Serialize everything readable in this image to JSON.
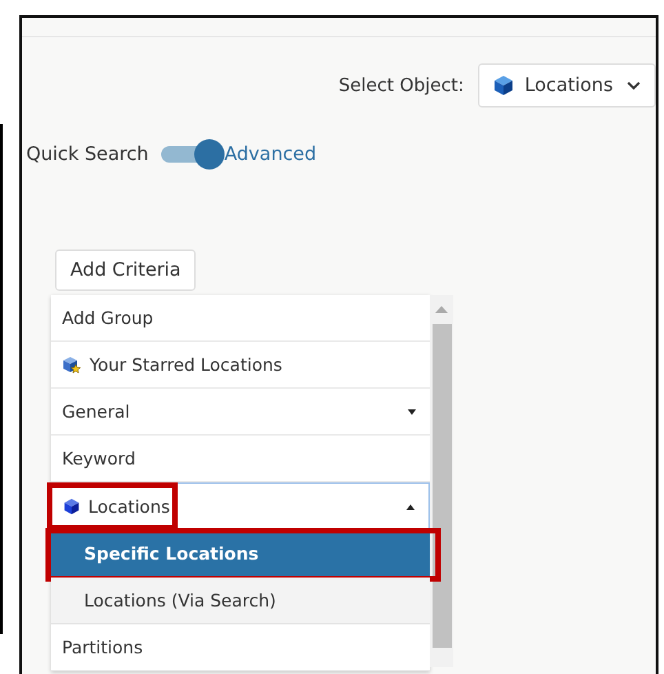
{
  "select_object": {
    "label": "Select Object:",
    "value": "Locations"
  },
  "search_mode": {
    "left_label": "Quick Search",
    "right_label": "Advanced",
    "on": true
  },
  "add_criteria_button": "Add Criteria",
  "criteria_menu": {
    "items": [
      {
        "label": "Add Group",
        "kind": "plain",
        "highlighted": false
      },
      {
        "label": "Your Starred Locations",
        "kind": "starred",
        "highlighted": false
      },
      {
        "label": "General",
        "kind": "group",
        "expanded": false,
        "highlighted": false
      },
      {
        "label": "Keyword",
        "kind": "plain",
        "highlighted": false
      },
      {
        "label": "Locations",
        "kind": "object-group",
        "expanded": true,
        "highlighted": true,
        "children": [
          {
            "label": "Specific Locations",
            "selected": true,
            "highlighted": true
          },
          {
            "label": "Locations (Via Search)",
            "selected": false,
            "highlighted": false
          }
        ]
      },
      {
        "label": "Partitions",
        "kind": "plain",
        "highlighted": false
      }
    ]
  }
}
